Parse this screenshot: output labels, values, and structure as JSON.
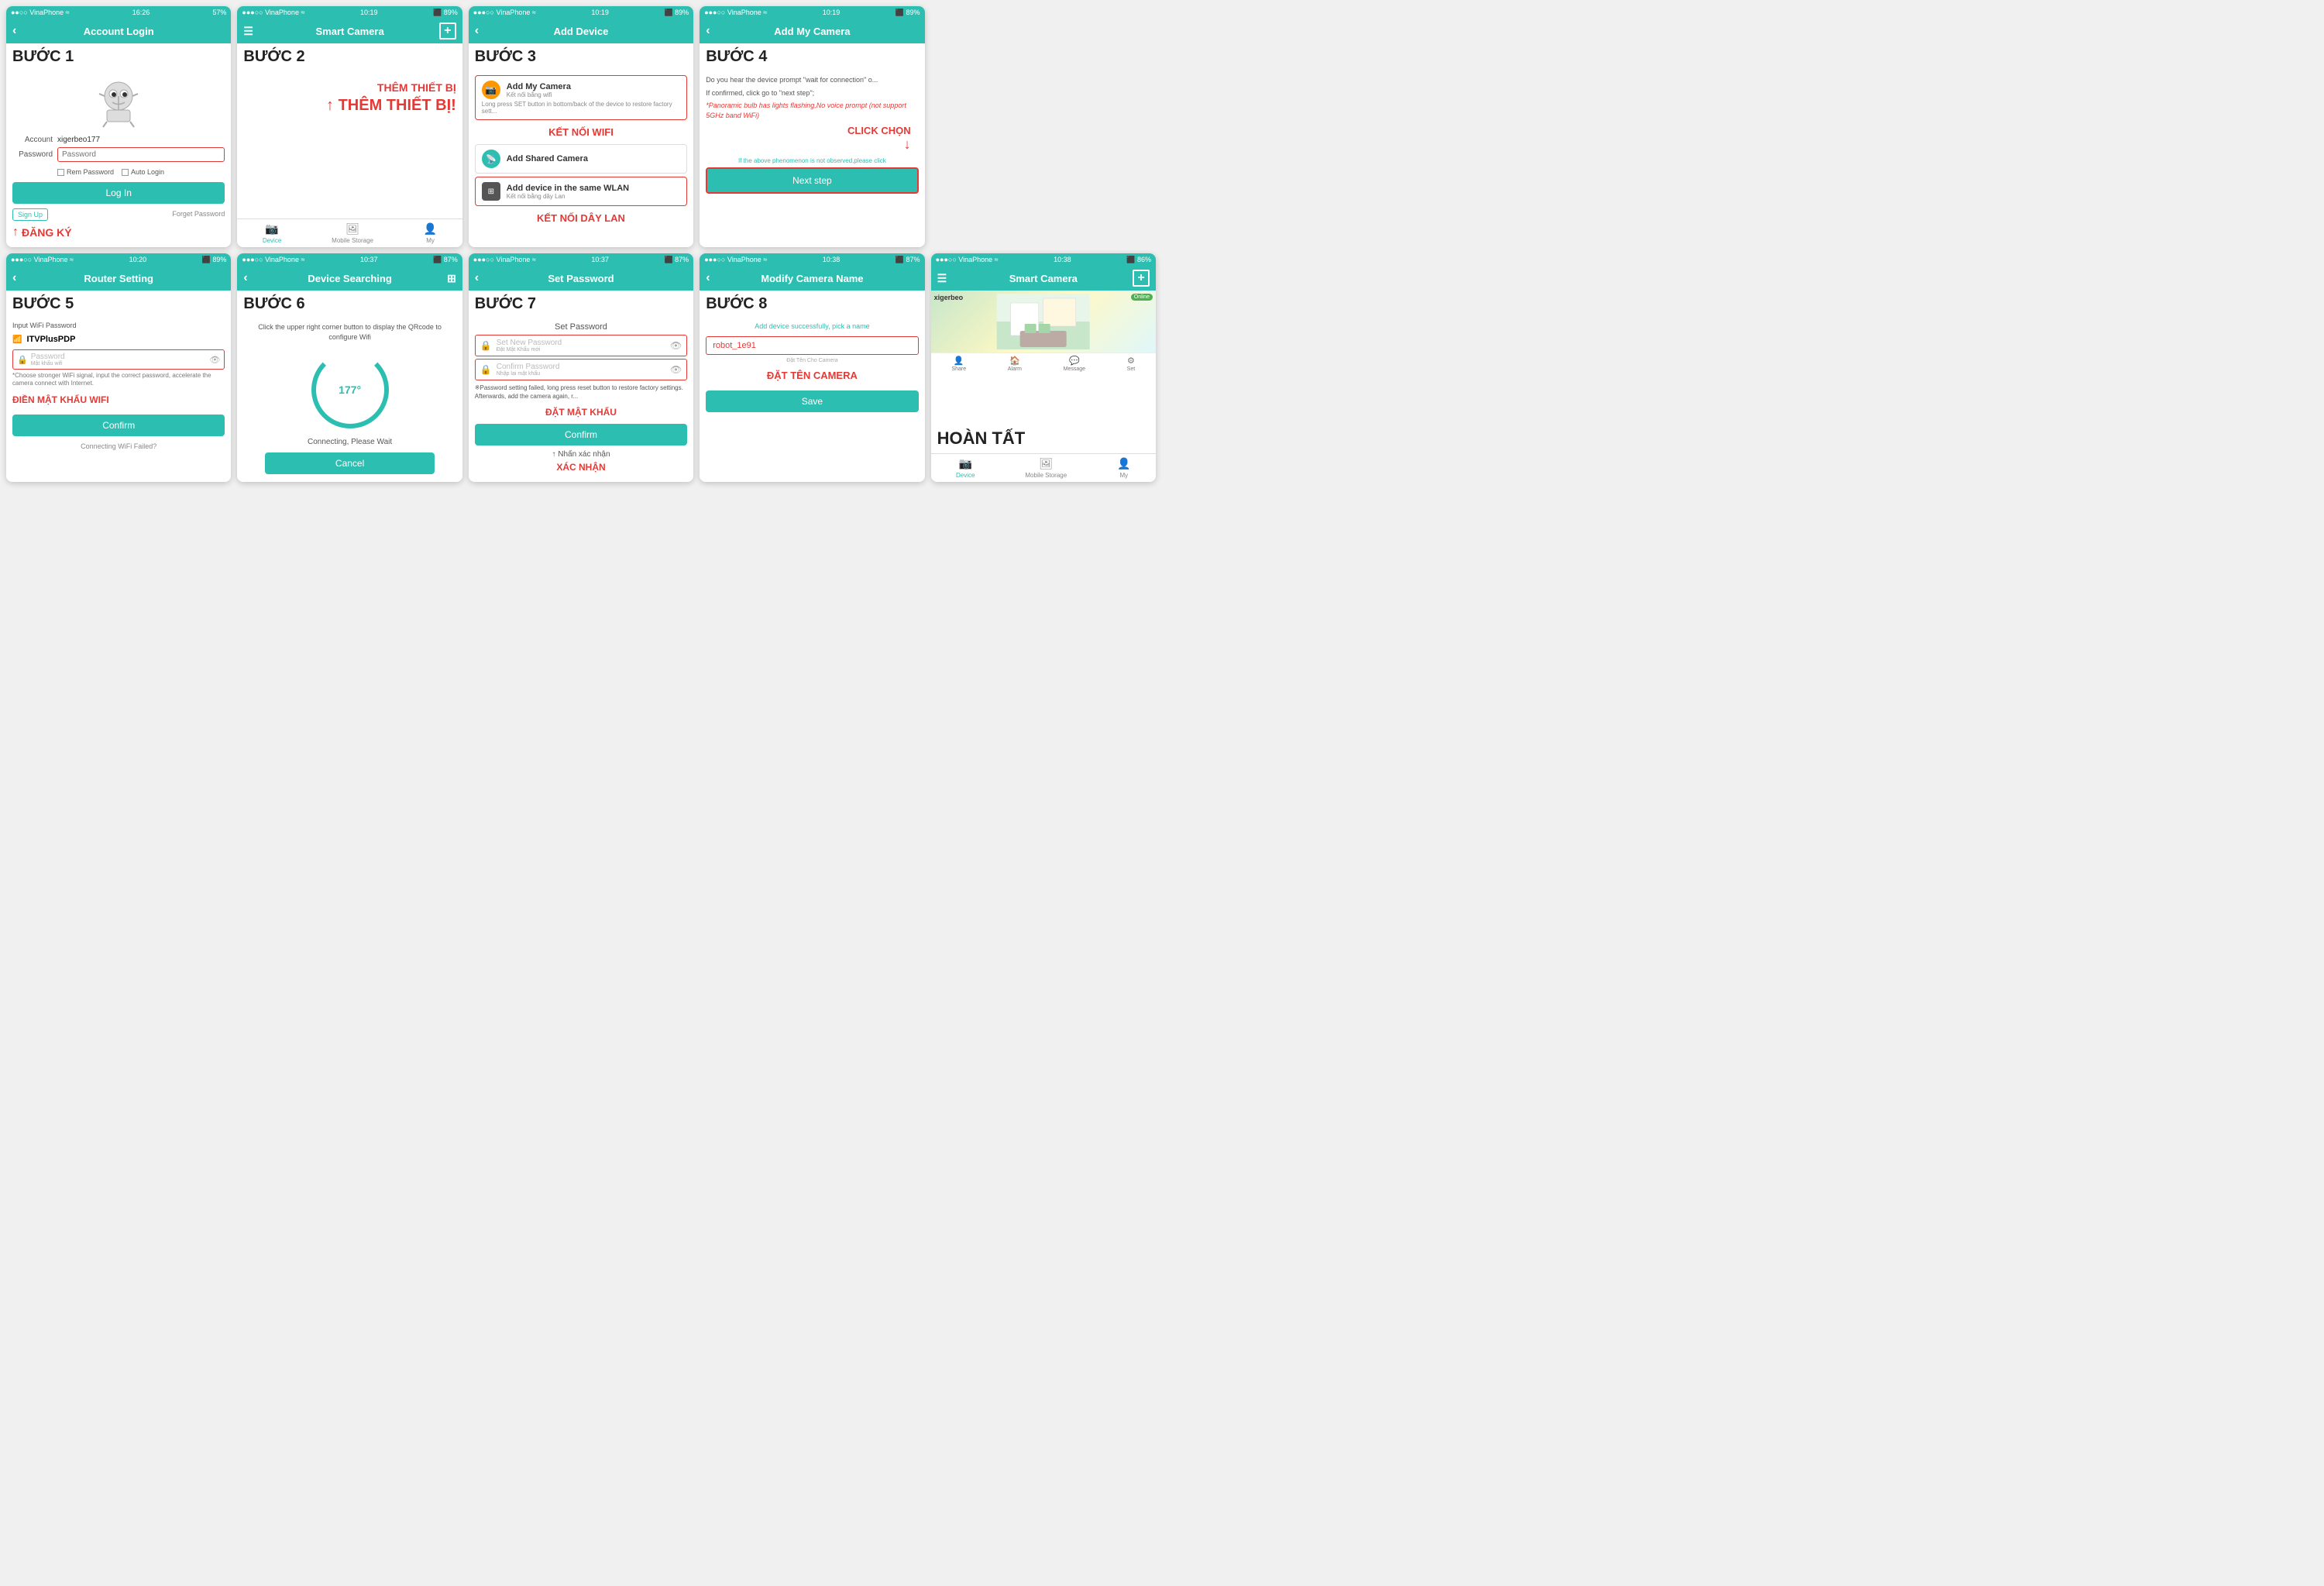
{
  "steps": [
    {
      "id": "step1",
      "stepLabel": "BƯỚC 1",
      "headerTitle": "Account Login",
      "account": "xigerbeo177",
      "passwordPlaceholder": "Password",
      "remPassword": "Rem Password",
      "autoLogin": "Auto Login",
      "loginBtn": "Log In",
      "signUp": "Sign Up",
      "forgetPassword": "Forget Password",
      "annotation": "↑ ĐĂNG KÝ"
    },
    {
      "id": "step2",
      "stepLabel": "BƯỚC 2",
      "headerTitle": "Smart Camera",
      "annotationTop": "THÊM THIẾT BỊ",
      "annotationArrow": "↑",
      "tabs": [
        "Device",
        "Mobile Storage",
        "My"
      ]
    },
    {
      "id": "step3",
      "stepLabel": "BƯỚC 3",
      "headerTitle": "Add Device",
      "option1Title": "Add My Camera",
      "option1Sub": "Kết nối bằng wifi",
      "option1Desc": "Long press SET button in bottom/back of the device to restore factory sett...",
      "option2Title": "Add Shared Camera",
      "option3Title": "Add device in the same WLAN",
      "option3Sub": "Kết nối bằng dây Lan",
      "annotation1": "KẾT NỐI WIFI",
      "annotation2": "KẾT NỐI DÂY LAN"
    },
    {
      "id": "step4",
      "stepLabel": "BƯỚC 4",
      "headerTitle": "Add My Camera",
      "desc1": "Do you hear the device prompt \"wait for connection\" o...",
      "desc2": "If confirmed, click go to \"next step\";",
      "desc3": "*Panoramic bulb has lights flashing,No voice prompt (not support 5GHz band WiFi)",
      "linkText": "If the above phenomenon is not observed,please click",
      "nextStepBtn": "Next step",
      "annotation": "CLICK CHỌN"
    },
    {
      "id": "step5",
      "stepLabel": "BƯỚC 5",
      "headerTitle": "Router Setting",
      "inputLabel": "Input WiFi Password",
      "networkName": "ITVPlusPDP",
      "passwordPlaceholder": "Password",
      "passwordSub": "Mật khẩu wifi",
      "note": "*Choose stronger WiFi signal, input the correct password, accelerate the camera connect with Internet.",
      "confirmBtn": "Confirm",
      "bottomText": "Connecting WiFi Failed?",
      "annotation": "ĐIỀN MẬT KHẨU WIFI"
    },
    {
      "id": "step6",
      "stepLabel": "BƯỚC 6",
      "headerTitle": "Device Searching",
      "instruction": "Click the upper right corner button to display the QRcode to configure Wifi",
      "degrees": "177°",
      "connectingText": "Connecting, Please Wait",
      "cancelBtn": "Cancel"
    },
    {
      "id": "step7",
      "stepLabel": "BƯỚC 7",
      "headerTitle": "Set Password",
      "setPasswordLabel": "Set Password",
      "newPasswordPlaceholder": "Set New Password",
      "newPasswordSub": "Đặt Mật Khẩu mới",
      "confirmPasswordPlaceholder": "Confirm Password",
      "confirmPasswordSub": "Nhập lại mật khẩu",
      "warningText": "※Password setting failed, long press reset button to restore factory settings. Afterwards, add the camera again, r...",
      "confirmBtn": "Confirm",
      "arrowLabel": "↑",
      "subLabel": "Nhấn xác nhận",
      "annotation1": "ĐẶT MẬT KHẨU",
      "annotation2": "XÁC NHẬN"
    },
    {
      "id": "step8",
      "stepLabel": "BƯỚC 8",
      "headerTitle": "Modify Camera Name",
      "successText": "Add device successfully, pick a name",
      "cameraNameValue": "robot_1e91",
      "cameraNameSub": "Đặt Tên Cho Camera",
      "saveBtn": "Save",
      "annotation": "ĐẶT TÊN CAMERA"
    },
    {
      "id": "step9",
      "stepLabel": "HOÀN TẤT",
      "headerTitle": "Smart Camera",
      "username": "xigerbeo",
      "onlineBadge": "Online",
      "tabs": [
        "Device",
        "Mobile Storage",
        "My"
      ],
      "actions": [
        "Share",
        "Alarm",
        "Message",
        "Set"
      ]
    }
  ],
  "statusBar": {
    "carrier": "VinaPhone",
    "time1": "16:26",
    "time2": "10:19",
    "battery": "57%",
    "battery2": "89%"
  },
  "colors": {
    "teal": "#2cbfb1",
    "red": "#e53935",
    "darkText": "#222222"
  }
}
